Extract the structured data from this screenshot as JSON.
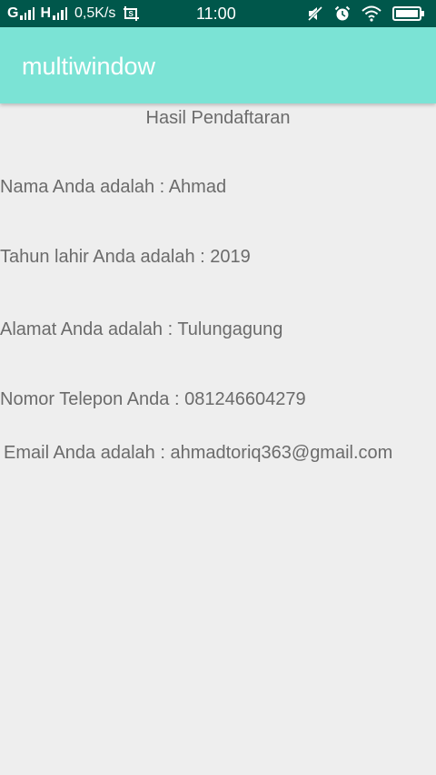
{
  "status_bar": {
    "sim1_letter": "G",
    "sim2_letter": "H",
    "network_speed": "0,5K/s",
    "time": "11:00",
    "icons": [
      "screenshot-icon",
      "mute-icon",
      "alarm-icon",
      "wifi-icon",
      "battery-icon"
    ]
  },
  "app_bar": {
    "title": "multiwindow",
    "color": "#7be3d5"
  },
  "content": {
    "heading": "Hasil Pendaftaran",
    "name_line": "Nama Anda adalah : Ahmad",
    "birth_year_line": "Tahun lahir Anda adalah : 2019",
    "address_line": "Alamat Anda adalah : Tulungagung",
    "phone_line": "Nomor Telepon Anda : 081246604279",
    "email_line": "Email Anda adalah : ahmadtoriq363@gmail.com"
  },
  "colors": {
    "status_bar": "#00574b",
    "background": "#eeeeee",
    "text": "#6b6b6b"
  }
}
